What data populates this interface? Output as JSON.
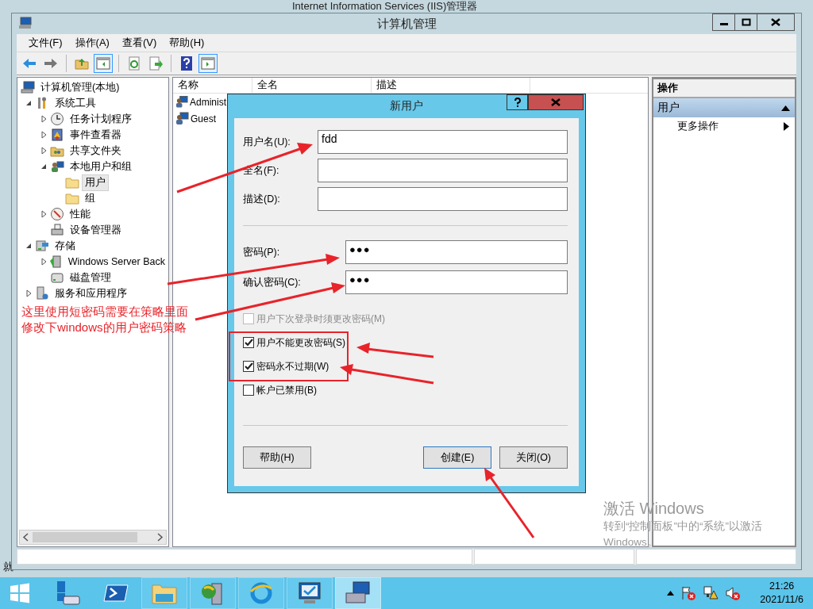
{
  "background_window": {
    "title": "Internet Information Services (IIS)管理器",
    "status": "就"
  },
  "window": {
    "title": "计算机管理"
  },
  "menu": [
    "文件(F)",
    "操作(A)",
    "查看(V)",
    "帮助(H)"
  ],
  "toolbar": [
    [
      {
        "kind": "back",
        "pressed": false
      },
      {
        "kind": "forward",
        "pressed": false
      }
    ],
    [
      {
        "kind": "up",
        "pressed": false
      },
      {
        "kind": "tree-pane",
        "pressed": true
      }
    ],
    [
      {
        "kind": "refresh",
        "pressed": false
      },
      {
        "kind": "export",
        "pressed": false
      }
    ],
    [
      {
        "kind": "help",
        "pressed": false
      },
      {
        "kind": "action-pane",
        "pressed": true
      }
    ]
  ],
  "tree": [
    {
      "label": "计算机管理(本地)",
      "kind": "computer",
      "selected": false,
      "children": [
        {
          "label": "系统工具",
          "kind": "tools",
          "selected": false,
          "expanded": true,
          "children": [
            {
              "label": "任务计划程序",
              "kind": "clock",
              "selected": false,
              "expanded": false
            },
            {
              "label": "事件查看器",
              "kind": "log",
              "selected": false,
              "expanded": false
            },
            {
              "label": "共享文件夹",
              "kind": "share",
              "selected": false,
              "expanded": false
            },
            {
              "label": "本地用户和组",
              "kind": "users",
              "selected": false,
              "expanded": true,
              "children": [
                {
                  "label": "用户",
                  "kind": "folder",
                  "selected": true
                },
                {
                  "label": "组",
                  "kind": "folder",
                  "selected": false
                }
              ]
            },
            {
              "label": "性能",
              "kind": "gauge",
              "selected": false,
              "expanded": false
            },
            {
              "label": "设备管理器",
              "kind": "device",
              "selected": false
            }
          ]
        },
        {
          "label": "存储",
          "kind": "storage",
          "selected": false,
          "expanded": true,
          "children": [
            {
              "label": "Windows Server Back",
              "kind": "backup",
              "selected": false,
              "expanded": false
            },
            {
              "label": "磁盘管理",
              "kind": "disk",
              "selected": false
            }
          ]
        },
        {
          "label": "服务和应用程序",
          "kind": "services",
          "selected": false,
          "expanded": false
        }
      ]
    }
  ],
  "list": {
    "columns": [
      "名称",
      "全名",
      "描述"
    ],
    "rows": [
      {
        "name": "Administ",
        "selected": false
      },
      {
        "name": "Guest",
        "selected": false
      }
    ]
  },
  "actions": {
    "title": "操作",
    "sections": [
      {
        "label": "用户",
        "expanded": true,
        "items": [
          "更多操作"
        ]
      }
    ]
  },
  "dialog": {
    "title": "新用户",
    "field_groups": [
      [
        {
          "label": "用户名(U):",
          "kind": "text",
          "value": "fdd"
        },
        {
          "label": "全名(F):",
          "kind": "text"
        },
        {
          "label": "描述(D):",
          "kind": "text"
        }
      ],
      [
        {
          "label": "密码(P):",
          "kind": "password",
          "value": "●●●"
        },
        {
          "label": "确认密码(C):",
          "kind": "password",
          "value": "●●●"
        }
      ]
    ],
    "checkboxes": [
      {
        "label": "用户下次登录时须更改密码(M)",
        "checked": false,
        "disabled": true
      },
      {
        "label": "用户不能更改密码(S)",
        "checked": true,
        "disabled": false
      },
      {
        "label": "密码永不过期(W)",
        "checked": true,
        "disabled": false
      },
      {
        "label": "帐户已禁用(B)",
        "checked": false,
        "disabled": false
      }
    ],
    "buttons": [
      {
        "label": "帮助(H)",
        "default": false
      },
      {
        "label": "创建(E)",
        "default": true
      },
      {
        "label": "关闭(O)",
        "default": false
      }
    ]
  },
  "annotation": {
    "note": [
      "这里使用短密码需要在策略里面",
      "修改下windows的用户密码策略"
    ]
  },
  "watermark": {
    "title": "激活 Windows",
    "lines": [
      "转到“控制面板”中的“系统”以激活",
      "Windows。"
    ]
  },
  "taskbar": {
    "apps": [
      {
        "kind": "server-manager",
        "running": false,
        "selected": false
      },
      {
        "kind": "powershell",
        "running": false,
        "selected": false
      },
      {
        "kind": "explorer",
        "running": true,
        "selected": false
      },
      {
        "kind": "server-globe",
        "running": true,
        "selected": false
      },
      {
        "kind": "browser",
        "running": true,
        "selected": false
      },
      {
        "kind": "monitor",
        "running": true,
        "selected": false
      },
      {
        "kind": "computer-management",
        "running": true,
        "selected": true
      }
    ],
    "time": "21:26",
    "date": "2021/11/6"
  }
}
